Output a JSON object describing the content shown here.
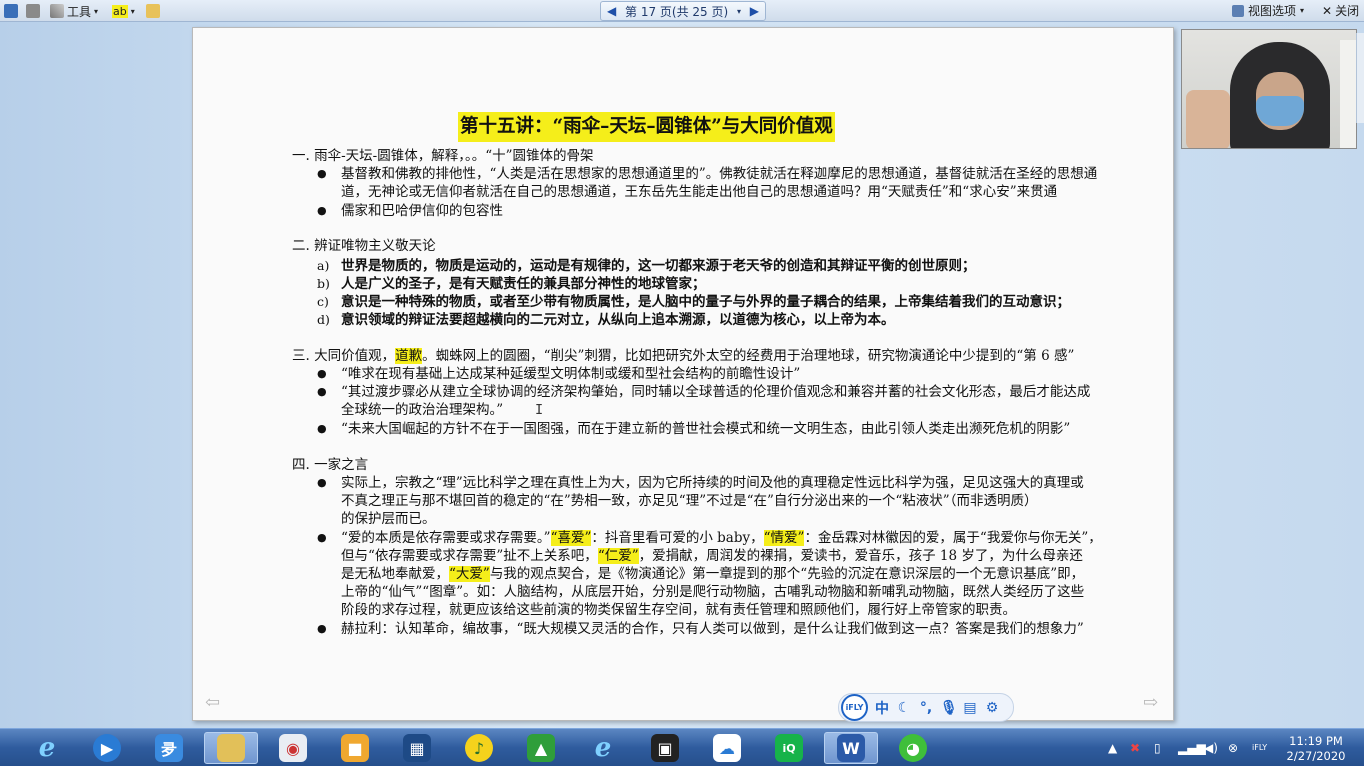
{
  "toolbar": {
    "tools_label": "工具",
    "spell_label": "ab",
    "pager_text": "第 17 页(共 25 页)",
    "view_options_label": "视图选项",
    "close_label": "关闭"
  },
  "document": {
    "title": "第十五讲：“雨伞–天坛–圆锥体”与大同价值观",
    "s1_heading": "一. 雨伞-天坛-圆锥体，解释，。。“十”圆锥体的骨架",
    "s1_b1_l1": "基督教和佛教的排他性，“人类是活在思想家的思想通道里的”。佛教徒就活在释迦摩尼的思想通道，基督徒就活在圣经的思想通",
    "s1_b1_l2": "道，无神论或无信仰者就活在自己的思想通道，王东岳先生能走出他自己的思想通道吗？用“天赋责任”和“求心安”来贯通",
    "s1_b2": "儒家和巴哈伊信仰的包容性",
    "s2_heading": "二. 辨证唯物主义敬天论",
    "s2_items": [
      {
        "marker": "a)",
        "text": "世界是物质的，物质是运动的，运动是有规律的，这一切都来源于老天爷的创造和其辩证平衡的创世原则；"
      },
      {
        "marker": "b)",
        "text": "人是广义的圣子，是有天赋责任的兼具部分神性的地球管家；"
      },
      {
        "marker": "c)",
        "text": "意识是一种特殊的物质，或者至少带有物质属性，是人脑中的量子与外界的量子耦合的结果，上帝集结着我们的互动意识；"
      },
      {
        "marker": "d)",
        "text": "意识领域的辩证法要超越横向的二元对立，从纵向上追本溯源，以道德为核心，以上帝为本。"
      }
    ],
    "s3_heading_pre": "三. 大同价值观，",
    "s3_heading_hl": "道歉",
    "s3_heading_post": "。蜘蛛网上的圆圈，“削尖”刺猬，比如把研究外太空的经费用于治理地球，研究物演通论中少提到的“第 6 感”",
    "s3_b1": "“唯求在现有基础上达成某种延缓型文明体制或缓和型社会结构的前瞻性设计”",
    "s3_b2_l1": "“其过渡步骤必从建立全球协调的经济架构肇始，同时辅以全球普适的伦理价值观念和兼容并蓄的社会文化形态，最后才能达成",
    "s3_b2_l2": "全球统一的政治治理架构。”",
    "s3_b3": "“未来大国崛起的方针不在于一国图强，而在于建立新的普世社会模式和统一文明生态，由此引领人类走出濒死危机的阴影”",
    "s4_heading": "四. 一家之言",
    "s4_b1_l1": "实际上，宗教之“理”远比科学之理在真性上为大，因为它所持续的时间及他的真理稳定性远比科学为强，足见这强大的真理或",
    "s4_b1_l2": "不真之理正与那不堪回首的稳定的“在”势相一致，亦足见“理”不过是“在”自行分泌出来的一个“粘液状”（而非透明质）",
    "s4_b1_l3": "的保护层而已。",
    "s4_b2_l1_a": "“爱的本质是依存需要或求存需要。”",
    "s4_b2_l1_hl1": "“喜爱”",
    "s4_b2_l1_b": "：抖音里看可爱的小 baby，",
    "s4_b2_l1_hl2": "“情爱”",
    "s4_b2_l1_c": "：金岳霖对林徽因的爱，属于“我爱你与你无关”，",
    "s4_b2_l2_a": "但与“依存需要或求存需要”扯不上关系吧，",
    "s4_b2_l2_hl": "“仁爱”",
    "s4_b2_l2_b": "，爱捐献，周润发的裸捐，爱读书，爱音乐，孩子 18 岁了，为什么母亲还",
    "s4_b2_l3_a": "是无私地奉献爱，",
    "s4_b2_l3_hl": "“大爱”",
    "s4_b2_l3_b": "与我的观点契合，是《物演通论》第一章提到的那个“先验的沉淀在意识深层的一个无意识基底”即，",
    "s4_b2_l4": "上帝的“仙气”“图章”。如：人脑结构，从底层开始，分别是爬行动物脑，古哺乳动物脑和新哺乳动物脑，既然人类经历了这些",
    "s4_b2_l5": "阶段的求存过程，就更应该给这些前演的物类保留生存空间，就有责任管理和照顾他们，履行好上帝管家的职责。",
    "s4_b3": "赫拉利：认知革命，编故事，“既大规模又灵活的合作，只有人类可以做到，是什么让我们做到这一点？答案是我们的想象力”"
  },
  "ifly": {
    "logo": "iFLY",
    "lang": "中"
  },
  "clock": {
    "time": "11:19 PM",
    "date": "2/27/2020"
  },
  "colors": {
    "highlight": "#f5ee1a",
    "taskbar": "#2f5c9e"
  }
}
